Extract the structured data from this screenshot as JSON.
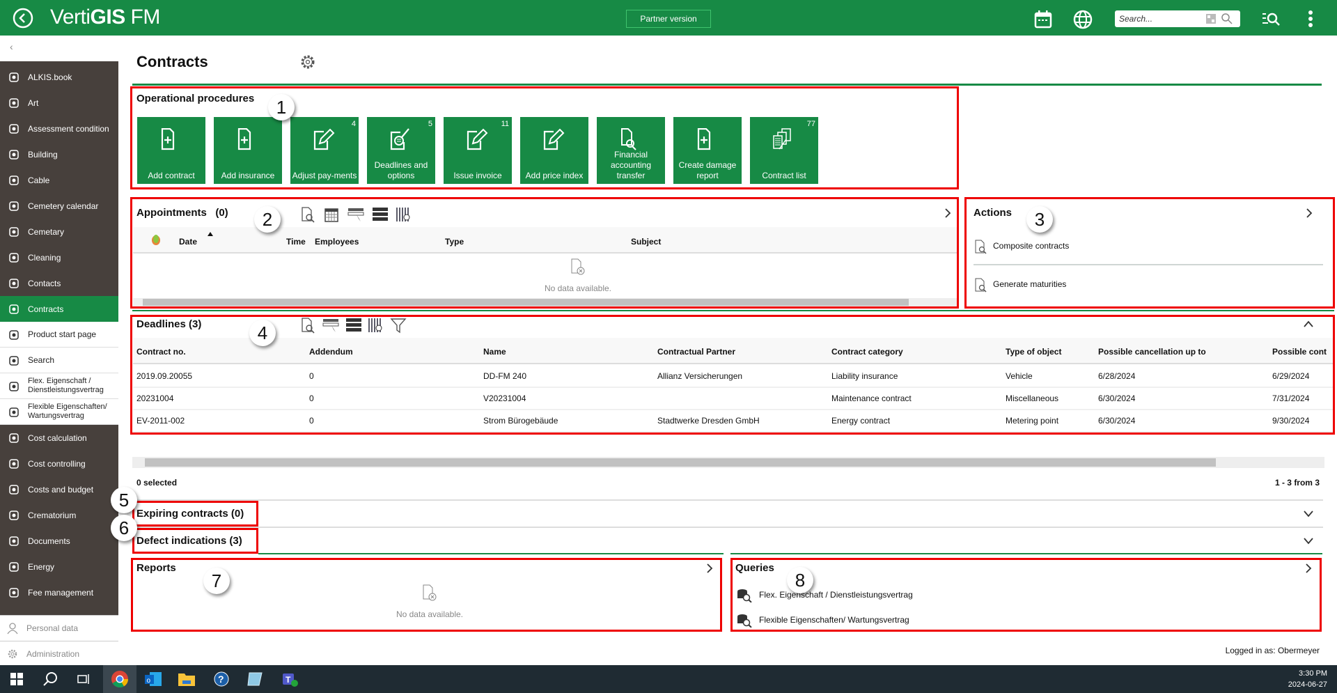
{
  "header": {
    "app_title_light": "Verti",
    "app_title_bold": "GIS",
    "app_title_suffix": " FM",
    "partner": "Partner version",
    "search_placeholder": "Search..."
  },
  "sidebar": {
    "collapse": "‹",
    "items": [
      {
        "label": "ALKIS.book",
        "icon": "map-pin-person-icon"
      },
      {
        "label": "Art",
        "icon": "palette-icon"
      },
      {
        "label": "Assessment condition",
        "icon": "stars-icon"
      },
      {
        "label": "Building",
        "icon": "house-icon"
      },
      {
        "label": "Cable",
        "icon": "cable-icon"
      },
      {
        "label": "Cemetery calendar",
        "icon": "calendar-icon"
      },
      {
        "label": "Cemetary",
        "icon": "arch-icon"
      },
      {
        "label": "Cleaning",
        "icon": "mop-icon"
      },
      {
        "label": "Contacts",
        "icon": "contacts-icon"
      },
      {
        "label": "Contracts",
        "icon": "contract-icon",
        "active": true
      },
      {
        "label": "Product start page",
        "icon": "home-person-icon"
      },
      {
        "label": "Search",
        "icon": "search-list-icon"
      },
      {
        "label": "Flex. Eigenschaft / Dienstleistungsvertrag",
        "icon": "query-icon"
      },
      {
        "label": "Flexible Eigenschaften/ Wartungsvertrag",
        "icon": "query-icon"
      },
      {
        "label": "Cost calculation",
        "icon": "euro-search-icon"
      },
      {
        "label": "Cost controlling",
        "icon": "euro-icon"
      },
      {
        "label": "Costs and budget",
        "icon": "dollar-icon"
      },
      {
        "label": "Crematorium",
        "icon": "flame-icon"
      },
      {
        "label": "Documents",
        "icon": "documents-icon"
      },
      {
        "label": "Energy",
        "icon": "bulb-icon"
      },
      {
        "label": "Fee management",
        "icon": "fee-icon"
      }
    ],
    "bottom": [
      {
        "label": "Personal data",
        "icon": "person-icon"
      },
      {
        "label": "Administration",
        "icon": "gear-icon"
      }
    ]
  },
  "page": {
    "title": "Contracts",
    "logged_in": "Logged in as: Obermeyer"
  },
  "operational": {
    "title": "Operational procedures",
    "tiles": [
      {
        "label": "Add contract",
        "count": "",
        "icon": "add-document-icon"
      },
      {
        "label": "Add insurance",
        "count": "",
        "icon": "add-document-icon"
      },
      {
        "label": "Adjust pay-ments",
        "count": "4",
        "icon": "edit-icon"
      },
      {
        "label": "Deadlines and options",
        "count": "5",
        "icon": "document-search-icon"
      },
      {
        "label": "Issue invoice",
        "count": "11",
        "icon": "edit-icon"
      },
      {
        "label": "Add price index",
        "count": "",
        "icon": "edit-icon"
      },
      {
        "label": "Financial accounting transfer",
        "count": "",
        "icon": "document-magnifier-icon"
      },
      {
        "label": "Create damage report",
        "count": "",
        "icon": "add-document-icon"
      },
      {
        "label": "Contract list",
        "count": "77",
        "icon": "document-stack-icon"
      }
    ]
  },
  "appointments": {
    "title": "Appointments",
    "count": "(0)",
    "columns": [
      "Date",
      "Time",
      "Employees",
      "Type",
      "Subject"
    ],
    "empty": "No data available."
  },
  "actions": {
    "title": "Actions",
    "items": [
      "Composite contracts",
      "Generate maturities"
    ]
  },
  "deadlines": {
    "title": "Deadlines (3)",
    "columns": [
      "Contract no.",
      "Addendum",
      "Name",
      "Contractual Partner",
      "Contract category",
      "Type of object",
      "Possible cancellation up to",
      "Possible cont"
    ],
    "rows": [
      [
        "2019.09.20055",
        "0",
        "DD-FM 240",
        "Allianz Versicherungen",
        "Liability insurance",
        "Vehicle",
        "6/28/2024",
        "6/29/2024"
      ],
      [
        "20231004",
        "0",
        "V20231004",
        "",
        "Maintenance contract",
        "Miscellaneous",
        "6/30/2024",
        "7/31/2024"
      ],
      [
        "EV-2011-002",
        "0",
        "Strom Bürogebäude",
        "Stadtwerke Dresden GmbH",
        "Energy contract",
        "Metering point",
        "6/30/2024",
        "9/30/2024"
      ]
    ],
    "selected": "0 selected",
    "paging": "1 - 3 from 3"
  },
  "expiring": {
    "title": "Expiring contracts (0)"
  },
  "defects": {
    "title": "Defect indications (3)"
  },
  "reports": {
    "title": "Reports",
    "empty": "No data available."
  },
  "queries": {
    "title": "Queries",
    "items": [
      "Flex. Eigenschaft / Dienstleistungsvertrag",
      "Flexible Eigenschaften/ Wartungsvertrag"
    ]
  },
  "annotations": [
    "1",
    "2",
    "3",
    "4",
    "5",
    "6",
    "7",
    "8"
  ],
  "taskbar": {
    "time": "3:30 PM",
    "date": "2024-06-27"
  },
  "colors": {
    "brand": "#178a45",
    "sidebar": "#47403c",
    "highlight": "#e00000"
  }
}
